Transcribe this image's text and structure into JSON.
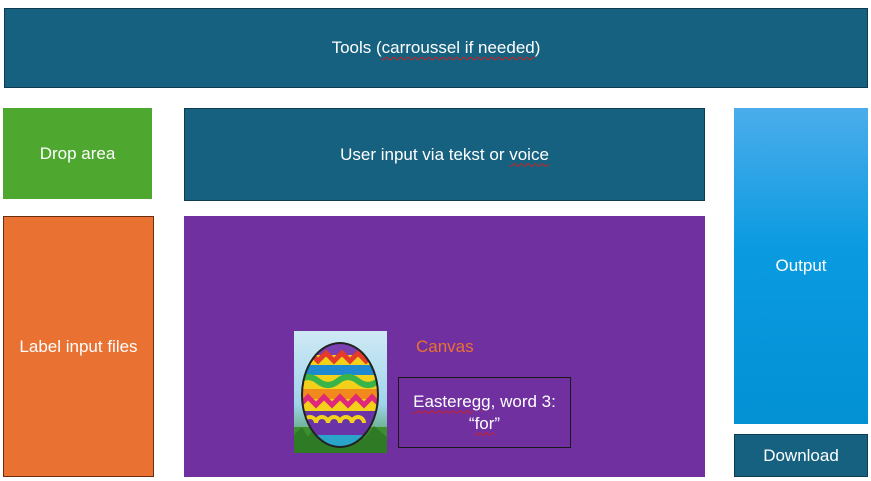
{
  "tools": {
    "prefix": "Tools (",
    "squiggle": "carroussel if needed",
    "suffix": ")"
  },
  "drop_area": "Drop area",
  "user_input": {
    "prefix": "User input via tekst or ",
    "squiggle": "voice"
  },
  "label_input_files": "Label input files",
  "output": "Output",
  "download": "Download",
  "canvas": {
    "label": "Canvas",
    "word_box": {
      "line1_squiggle": "Easteregg",
      "line1_rest": ", word 3:",
      "line2_open": "“",
      "line2_squiggle": "for",
      "line2_close": "”"
    }
  },
  "colors": {
    "tools": "#16617f",
    "drop": "#4ea72e",
    "label_files": "#e97132",
    "canvas": "#7030a0",
    "output": "#0a9ae0"
  }
}
